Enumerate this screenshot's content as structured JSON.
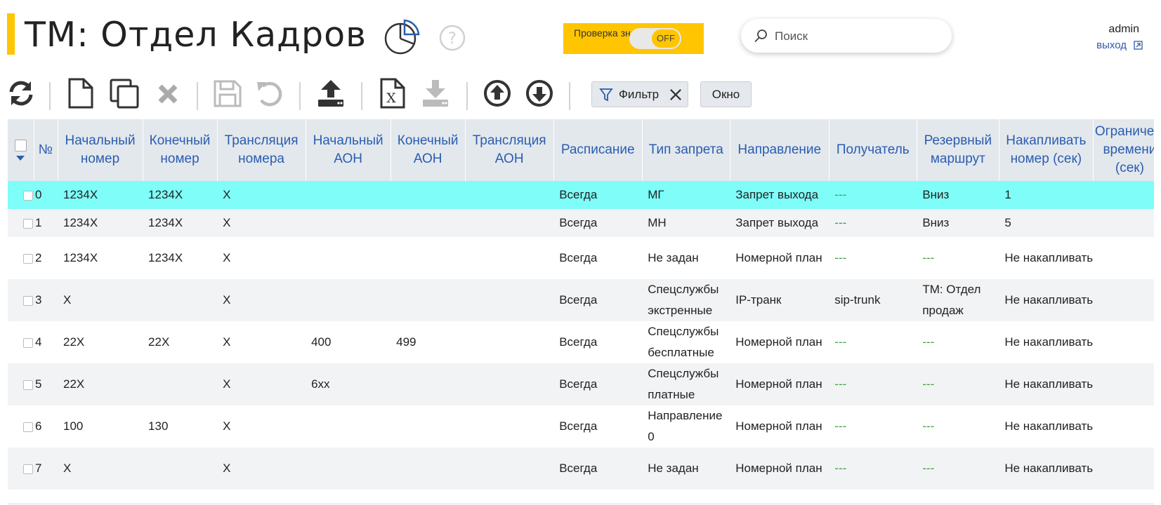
{
  "header": {
    "title": "ТМ: Отдел Кадров",
    "check_label": "Проверка значений",
    "toggle_state": "OFF",
    "search_placeholder": "Поиск",
    "user": "admin",
    "logout": "выход"
  },
  "icons": [
    "refresh-icon",
    "new-file-icon",
    "copy-icon",
    "delete-icon",
    "save-icon",
    "undo-icon",
    "upload-icon",
    "excel-icon",
    "download-icon",
    "move-up-icon",
    "move-down-icon"
  ],
  "toolbar": {
    "filter_label": "Фильтр",
    "window_label": "Окно"
  },
  "table": {
    "headers": {
      "num": "№",
      "start_number": "Начальный номер",
      "end_number": "Конечный номер",
      "translation_number": "Трансляция номера",
      "start_aon": "Начальный АОН",
      "end_aon": "Конечный АОН",
      "translation_aon": "Трансляция АОН",
      "schedule": "Расписание",
      "ban_type": "Тип запрета",
      "direction": "Направление",
      "recipient": "Получатель",
      "backup_route": "Резервный маршрут",
      "accumulate": "Накапливать номер (сек)",
      "limit": "Ограничение времени (сек)"
    },
    "rows": [
      {
        "num": "0",
        "start": "1234X",
        "end": "1234X",
        "trans": "X",
        "start_aon": "",
        "end_aon": "",
        "trans_aon": "",
        "schedule": "Всегда",
        "ban": "МГ",
        "direction": "Запрет выхода",
        "recipient": "---",
        "backup": "Вниз",
        "accumulate": "1"
      },
      {
        "num": "1",
        "start": "1234X",
        "end": "1234X",
        "trans": "X",
        "start_aon": "",
        "end_aon": "",
        "trans_aon": "",
        "schedule": "Всегда",
        "ban": "МН",
        "direction": "Запрет выхода",
        "recipient": "---",
        "backup": "Вниз",
        "accumulate": "5"
      },
      {
        "num": "2",
        "start": "1234X",
        "end": "1234X",
        "trans": "X",
        "start_aon": "",
        "end_aon": "",
        "trans_aon": "",
        "schedule": "Всегда",
        "ban": "Не задан",
        "direction": "Номерной план",
        "recipient": "---",
        "backup": "---",
        "accumulate": "Не накапливать"
      },
      {
        "num": "3",
        "start": "X",
        "end": "",
        "trans": "X",
        "start_aon": "",
        "end_aon": "",
        "trans_aon": "",
        "schedule": "Всегда",
        "ban": "Спецслужбы экстренные",
        "direction": "IP-транк",
        "recipient": "sip-trunk",
        "backup": "ТМ: Отдел продаж",
        "accumulate": "Не накапливать"
      },
      {
        "num": "4",
        "start": "22X",
        "end": "22X",
        "trans": "X",
        "start_aon": "400",
        "end_aon": "499",
        "trans_aon": "",
        "schedule": "Всегда",
        "ban": "Спецслужбы бесплатные",
        "direction": "Номерной план",
        "recipient": "---",
        "backup": "---",
        "accumulate": "Не накапливать"
      },
      {
        "num": "5",
        "start": "22X",
        "end": "",
        "trans": "X",
        "start_aon": "6xx",
        "end_aon": "",
        "trans_aon": "",
        "schedule": "Всегда",
        "ban": "Спецслужбы платные",
        "direction": "Номерной план",
        "recipient": "---",
        "backup": "---",
        "accumulate": "Не накапливать"
      },
      {
        "num": "6",
        "start": "100",
        "end": "130",
        "trans": "X",
        "start_aon": "",
        "end_aon": "",
        "trans_aon": "",
        "schedule": "Всегда",
        "ban": "Направление 0",
        "direction": "Номерной план",
        "recipient": "---",
        "backup": "---",
        "accumulate": "Не накапливать"
      },
      {
        "num": "7",
        "start": "X",
        "end": "",
        "trans": "X",
        "start_aon": "",
        "end_aon": "",
        "trans_aon": "",
        "schedule": "Всегда",
        "ban": "Не задан",
        "direction": "Номерной план",
        "recipient": "---",
        "backup": "---",
        "accumulate": "Не накапливать"
      }
    ]
  },
  "colors": {
    "accent": "#ffc500",
    "header_text": "#2a5db0",
    "selected_row": "#7efdf9",
    "dash": "#3aa43a"
  }
}
